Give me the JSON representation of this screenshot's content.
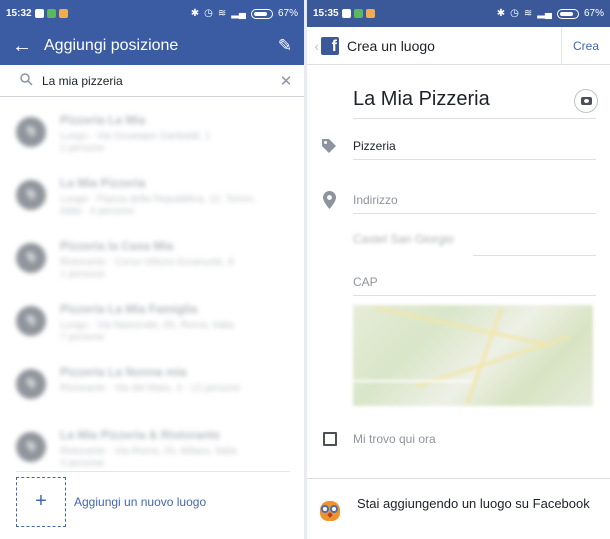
{
  "left": {
    "status": {
      "time": "15:32",
      "battery": "67%"
    },
    "appbar": {
      "title": "Aggiungi posizione",
      "back_icon": "arrow-left-icon",
      "edit_icon": "pencil-icon"
    },
    "search": {
      "value": "La mia pizzeria",
      "icon": "search-icon",
      "clear_icon": "close-icon"
    },
    "results": [
      {
        "name": "Pizzeria La Mia",
        "sub1": "Luogo · Via Giuseppe Garibaldi, 1",
        "sub2": "2 persone"
      },
      {
        "name": "La Mia Pizzeria",
        "sub1": "Luogo · Piazza della Repubblica, 12, Torino,",
        "sub2": "Italia · 4 persone"
      },
      {
        "name": "Pizzeria la Casa Mia",
        "sub1": "Ristorante · Corso Vittorio Emanuele, 8",
        "sub2": "1 persona"
      },
      {
        "name": "Pizzeria La Mia Famiglia",
        "sub1": "Luogo · Via Nazionale, 55, Roma, Italia",
        "sub2": "7 persone"
      },
      {
        "name": "Pizzeria La Nonna mia",
        "sub1": "Ristorante · Via del Mare, 3 · 12 persone",
        "sub2": ""
      },
      {
        "name": "La Mia Pizzeria & Ristorante",
        "sub1": "Ristorante · Via Roma, 20, Milano, Italia",
        "sub2": "3 persone"
      }
    ],
    "add": {
      "label": "Aggiungi un nuovo luogo",
      "icon": "plus-icon"
    }
  },
  "right": {
    "status": {
      "time": "15:35",
      "battery": "67%"
    },
    "header": {
      "title": "Crea un luogo",
      "action": "Crea"
    },
    "form": {
      "name": "La Mia Pizzeria",
      "category": "Pizzeria",
      "address_placeholder": "Indirizzo",
      "city": "Castel San Giorgio",
      "zip_placeholder": "CAP"
    },
    "checkbox_label": "Mi trovo qui ora",
    "footer_text": "Stai aggiungendo un luogo su Facebook"
  }
}
